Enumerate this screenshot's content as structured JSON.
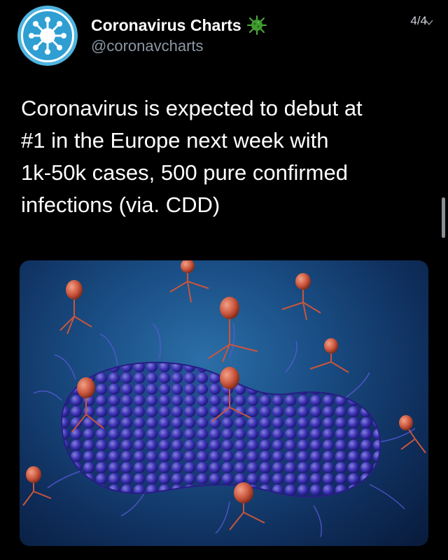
{
  "tweet": {
    "display_name": "Coronavirus Charts",
    "handle": "@coronavcharts",
    "counter": "4/4",
    "text": "Coronavirus is expected to debut at\n#1 in the Europe next week with\n1k-50k cases, 500 pure confirmed\ninfections (via. CDD)",
    "avatar_icon": "virus-logo-icon",
    "badge_icon": "virus-emoji-icon",
    "media_alt": "bacteriophage-illustration-image"
  },
  "colors": {
    "background": "#000000",
    "handle": "#8b98a5",
    "avatar": "#2f9fd3",
    "media_background": "#1a4f86"
  }
}
